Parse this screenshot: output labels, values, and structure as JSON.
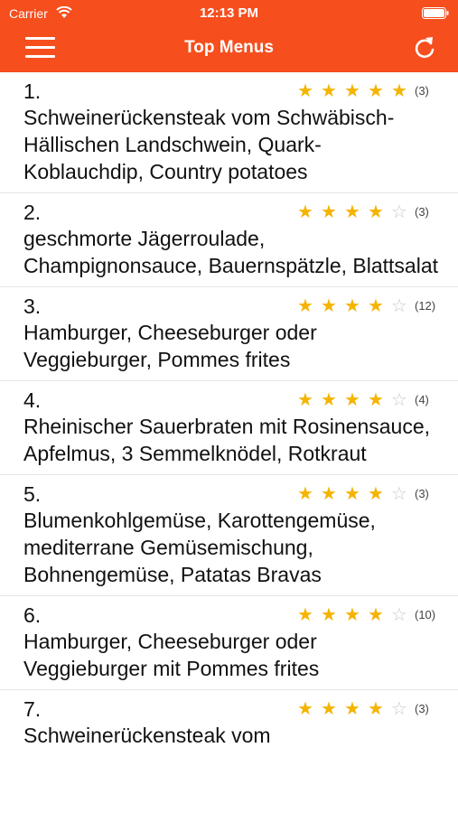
{
  "status": {
    "carrier": "Carrier",
    "time": "12:13 PM"
  },
  "nav": {
    "title": "Top Menus",
    "menu_icon": "hamburger-menu-icon",
    "refresh_icon": "refresh-icon"
  },
  "colors": {
    "header": "#f64e1d",
    "star_filled": "#f4b400",
    "star_empty": "#c9c9c9"
  },
  "items": [
    {
      "rank": "1.",
      "rating": 5,
      "count": "(3)",
      "name": "Schweinerückensteak vom Schwäbisch-Hällischen Landschwein, Quark-Koblauchdip, Country potatoes"
    },
    {
      "rank": "2.",
      "rating": 4,
      "count": "(3)",
      "name": "geschmorte Jägerroulade, Champignonsauce, Bauernspätzle, Blattsalat"
    },
    {
      "rank": "3.",
      "rating": 4,
      "count": "(12)",
      "name": "Hamburger, Cheeseburger oder Veggieburger, Pommes frites"
    },
    {
      "rank": "4.",
      "rating": 4,
      "count": "(4)",
      "name": "Rheinischer Sauerbraten mit Rosinensauce, Apfelmus, 3 Semmelknödel, Rotkraut"
    },
    {
      "rank": "5.",
      "rating": 4,
      "count": "(3)",
      "name": "Blumenkohlgemüse, Karottengemüse, mediterrane Gemüsemischung, Bohnengemüse, Patatas Bravas"
    },
    {
      "rank": "6.",
      "rating": 4,
      "count": "(10)",
      "name": "Hamburger, Cheeseburger oder Veggieburger mit Pommes frites"
    },
    {
      "rank": "7.",
      "rating": 4,
      "count": "(3)",
      "name": "Schweinerückensteak vom"
    }
  ]
}
